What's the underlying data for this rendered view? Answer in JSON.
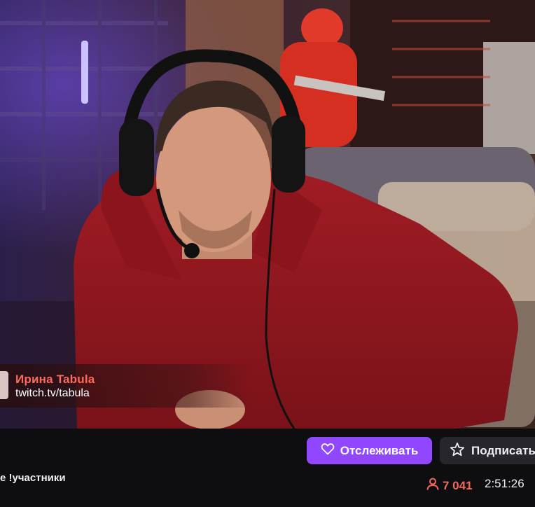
{
  "overlay": {
    "name": "Ирина Tabula",
    "url": "twitch.tv/tabula"
  },
  "channel": {
    "follow_label": "Отслеживать",
    "subscribe_label": "Подписаться",
    "stream_title": "е !участники",
    "viewer_count": "7 041",
    "uptime": "2:51:26"
  },
  "icons": {
    "follow": "heart-icon",
    "subscribe": "star-icon",
    "viewers": "person-icon"
  },
  "colors": {
    "accent": "#9147ff",
    "live_red": "#f5675a",
    "overlay_name": "#ff6a5c",
    "background": "#0e0e10"
  }
}
